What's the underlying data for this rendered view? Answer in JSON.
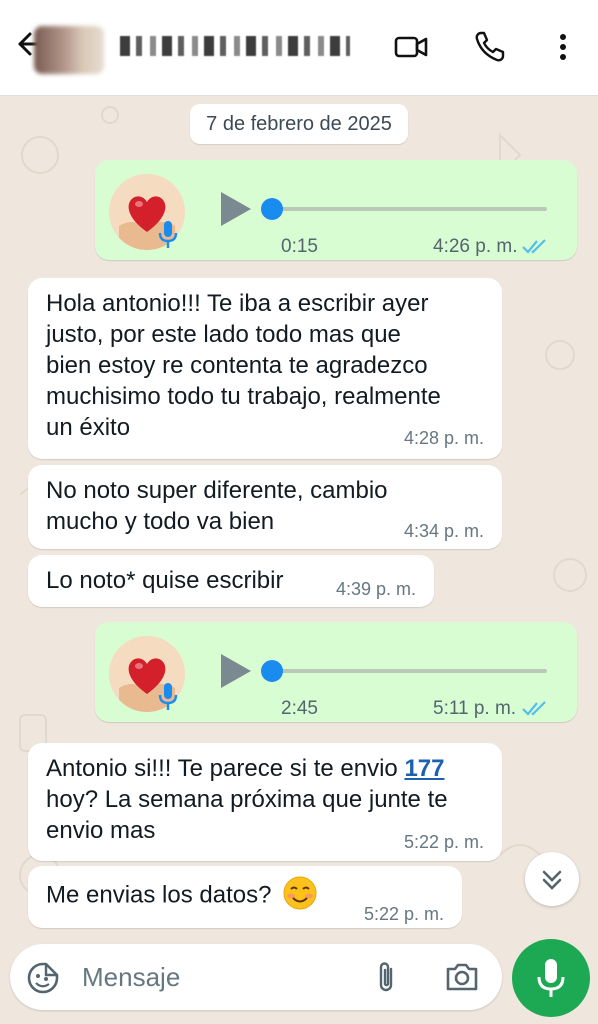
{
  "header": {
    "contact_name_redacted": "",
    "icons": [
      "back-arrow-icon",
      "video-call-icon",
      "phone-icon",
      "more-options-icon"
    ]
  },
  "chat": {
    "date_chip": "7 de febrero de 2025",
    "messages": [
      {
        "type": "voice",
        "direction": "out",
        "duration": "0:15",
        "time": "4:26 p. m.",
        "status": "read"
      },
      {
        "type": "text",
        "direction": "in",
        "lines": [
          "Hola antonio!!! Te iba a escribir ayer",
          "justo, por este lado todo mas que",
          "bien estoy re contenta te agradezco",
          "muchisimo todo tu trabajo, realmente",
          "un éxito"
        ],
        "time": "4:28 p. m."
      },
      {
        "type": "text",
        "direction": "in",
        "lines": [
          "No noto super diferente, cambio",
          "mucho y todo va bien"
        ],
        "time": "4:34 p. m."
      },
      {
        "type": "text",
        "direction": "in",
        "lines": [
          "Lo noto* quise escribir"
        ],
        "time": "4:39 p. m."
      },
      {
        "type": "voice",
        "direction": "out",
        "duration": "2:45",
        "time": "5:11 p. m.",
        "status": "read"
      },
      {
        "type": "text",
        "direction": "in",
        "line1_prefix": "Antonio si!!! Te parece si te envio ",
        "line1_link": "177",
        "lines_rest": [
          "hoy? La semana próxima que junte te",
          "envio mas"
        ],
        "time": "5:22 p. m."
      },
      {
        "type": "text",
        "direction": "in",
        "text": "Me envias los datos?",
        "emoji": "smiling-face-emoji",
        "time": "5:22 p. m."
      }
    ]
  },
  "composer": {
    "placeholder": "Mensaje",
    "icons": [
      "emoji-sticker-icon",
      "attach-clip-icon",
      "camera-icon",
      "microphone-icon"
    ]
  },
  "colors": {
    "background": "#efe7dd",
    "outgoing_bubble": "#d9fdd3",
    "incoming_bubble": "#ffffff",
    "accent_green": "#1da854",
    "read_ticks": "#53bdeb",
    "link": "#1d5fb0"
  }
}
